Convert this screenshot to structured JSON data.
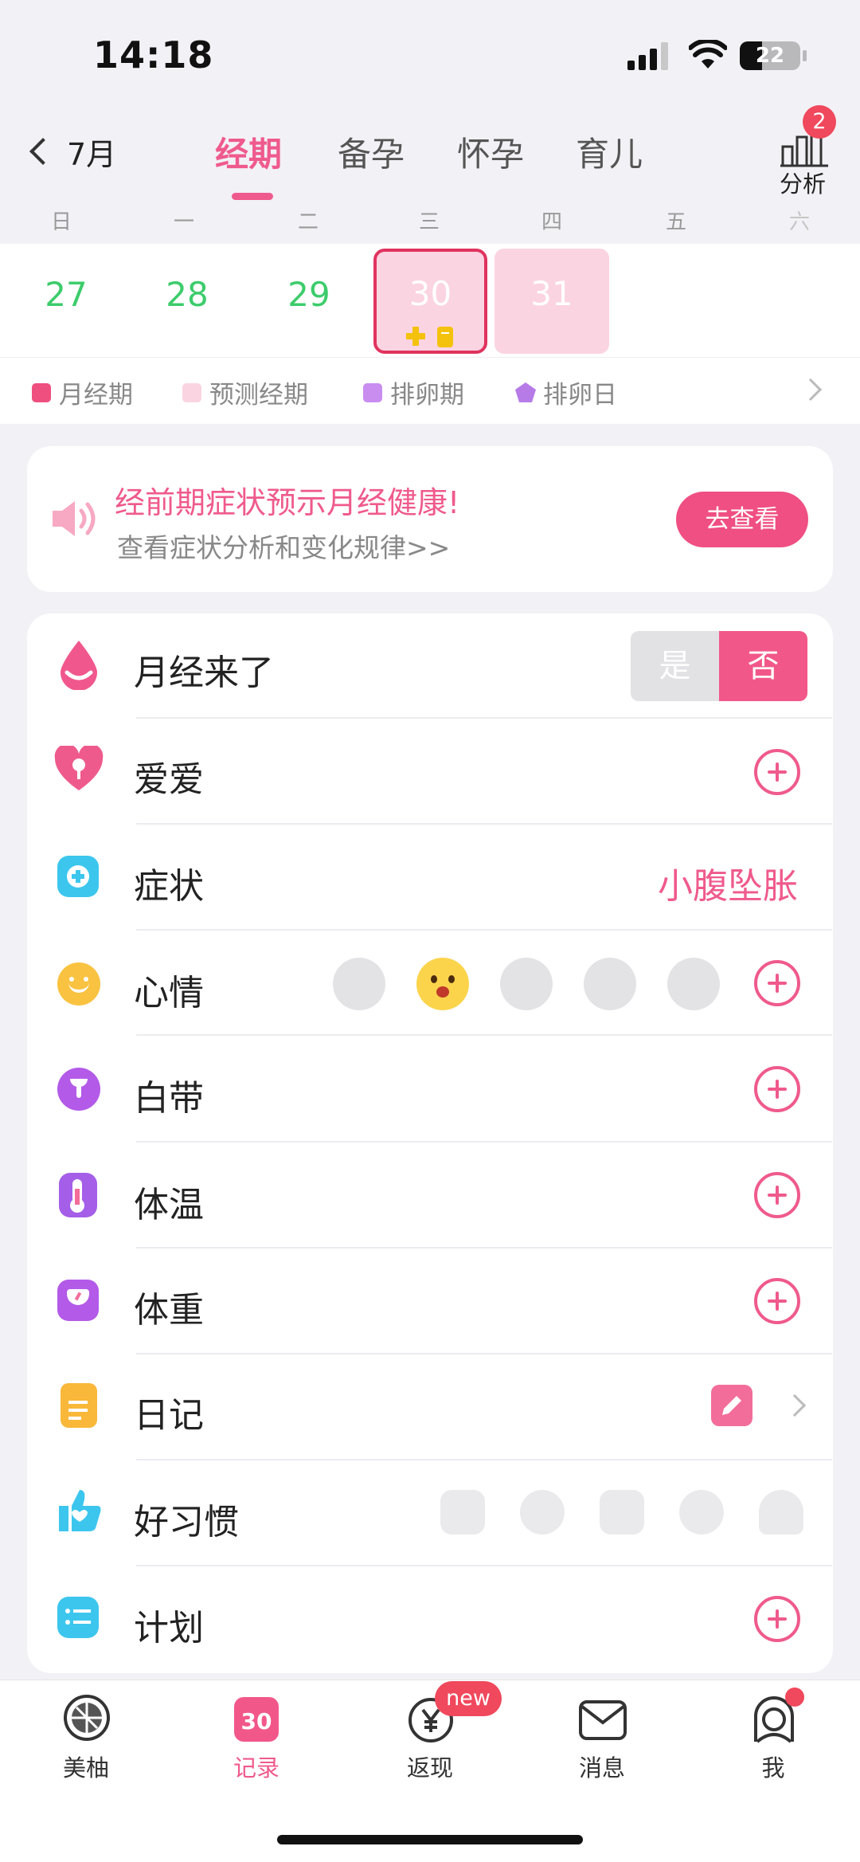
{
  "status_bar": {
    "time": "14:18",
    "battery": "22"
  },
  "nav": {
    "back_label": "7月",
    "tabs": [
      "经期",
      "备孕",
      "怀孕",
      "育儿"
    ],
    "active_tab": 0,
    "analysis_label": "分析",
    "analysis_badge": "2"
  },
  "weekdays": [
    "日",
    "一",
    "二",
    "三",
    "四",
    "五",
    "六"
  ],
  "calendar": {
    "days": [
      "27",
      "28",
      "29",
      "30",
      "31"
    ],
    "selected_day": "30"
  },
  "legend": [
    "月经期",
    "预测经期",
    "排卵期",
    "排卵日"
  ],
  "promo": {
    "title": "经前期症状预示月经健康!",
    "subtitle": "查看症状分析和变化规律>>",
    "button": "去查看"
  },
  "records": {
    "period": {
      "label": "月经来了",
      "yes": "是",
      "no": "否",
      "selected": "否"
    },
    "love": {
      "label": "爱爱"
    },
    "symptom": {
      "label": "症状",
      "value": "小腹坠胀"
    },
    "mood": {
      "label": "心情"
    },
    "discharge": {
      "label": "白带"
    },
    "temperature": {
      "label": "体温"
    },
    "weight": {
      "label": "体重"
    },
    "diary": {
      "label": "日记"
    },
    "habit": {
      "label": "好习惯"
    },
    "plan": {
      "label": "计划"
    }
  },
  "bottom_nav": {
    "items": [
      "美柚",
      "记录",
      "返现",
      "消息",
      "我"
    ],
    "active": 1,
    "record_day": "30",
    "new_badge": "new"
  },
  "colors": {
    "accent": "#ef5a8d",
    "green_day": "#3ccc6b",
    "period_light": "#fbd4e1"
  }
}
